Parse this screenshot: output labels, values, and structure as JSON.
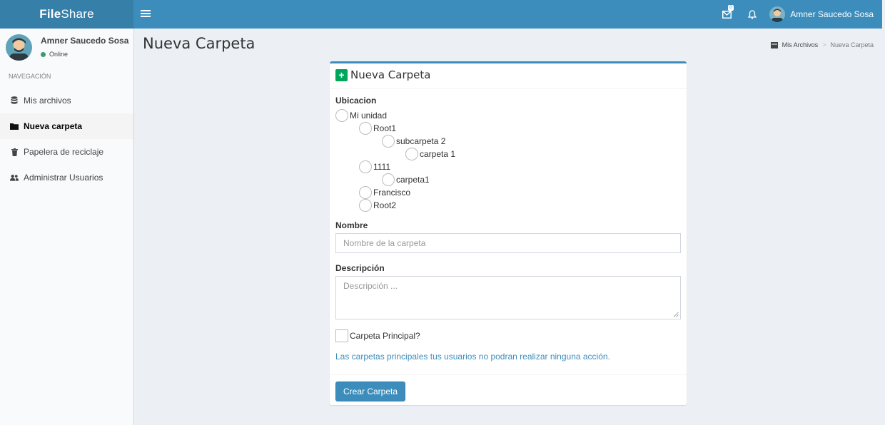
{
  "app": {
    "logo_bold": "File",
    "logo_rest": "Share"
  },
  "header": {
    "mail_badge": "0",
    "user_name": "Amner Saucedo Sosa"
  },
  "sidebar": {
    "user_name": "Amner Saucedo Sosa",
    "status": "Online",
    "nav_header": "NAVEGACIÓN",
    "items": [
      {
        "label": "Mis archivos",
        "icon": "database-icon"
      },
      {
        "label": "Nueva carpeta",
        "icon": "folder-icon",
        "active": true
      },
      {
        "label": "Papelera de reciclaje",
        "icon": "trash-icon"
      },
      {
        "label": "Administrar Usuarios",
        "icon": "users-icon"
      }
    ]
  },
  "page": {
    "title": "Nueva Carpeta",
    "breadcrumb": {
      "home": "Mis Archivos",
      "current": "Nueva Carpeta"
    }
  },
  "form": {
    "box_title": "Nueva Carpeta",
    "location_label": "Ubicacion",
    "tree": [
      {
        "label": "Mi unidad",
        "level": 0
      },
      {
        "label": "Root1",
        "level": 1
      },
      {
        "label": "subcarpeta 2",
        "level": 2
      },
      {
        "label": "carpeta 1",
        "level": 3
      },
      {
        "label": "1111",
        "level": 1
      },
      {
        "label": "carpeta1",
        "level": 2
      },
      {
        "label": "Francisco",
        "level": 1
      },
      {
        "label": "Root2",
        "level": 1
      }
    ],
    "name_label": "Nombre",
    "name_placeholder": "Nombre de la carpeta",
    "description_label": "Descripción",
    "description_placeholder": "Descripción ...",
    "main_folder_label": "Carpeta Principal?",
    "help_text": "Las carpetas principales tus usuarios no podran realizar ninguna acción.",
    "submit_label": "Crear Carpeta"
  },
  "colors": {
    "primary": "#3c8dbc",
    "success": "#00a65a",
    "online": "#3d9970"
  }
}
